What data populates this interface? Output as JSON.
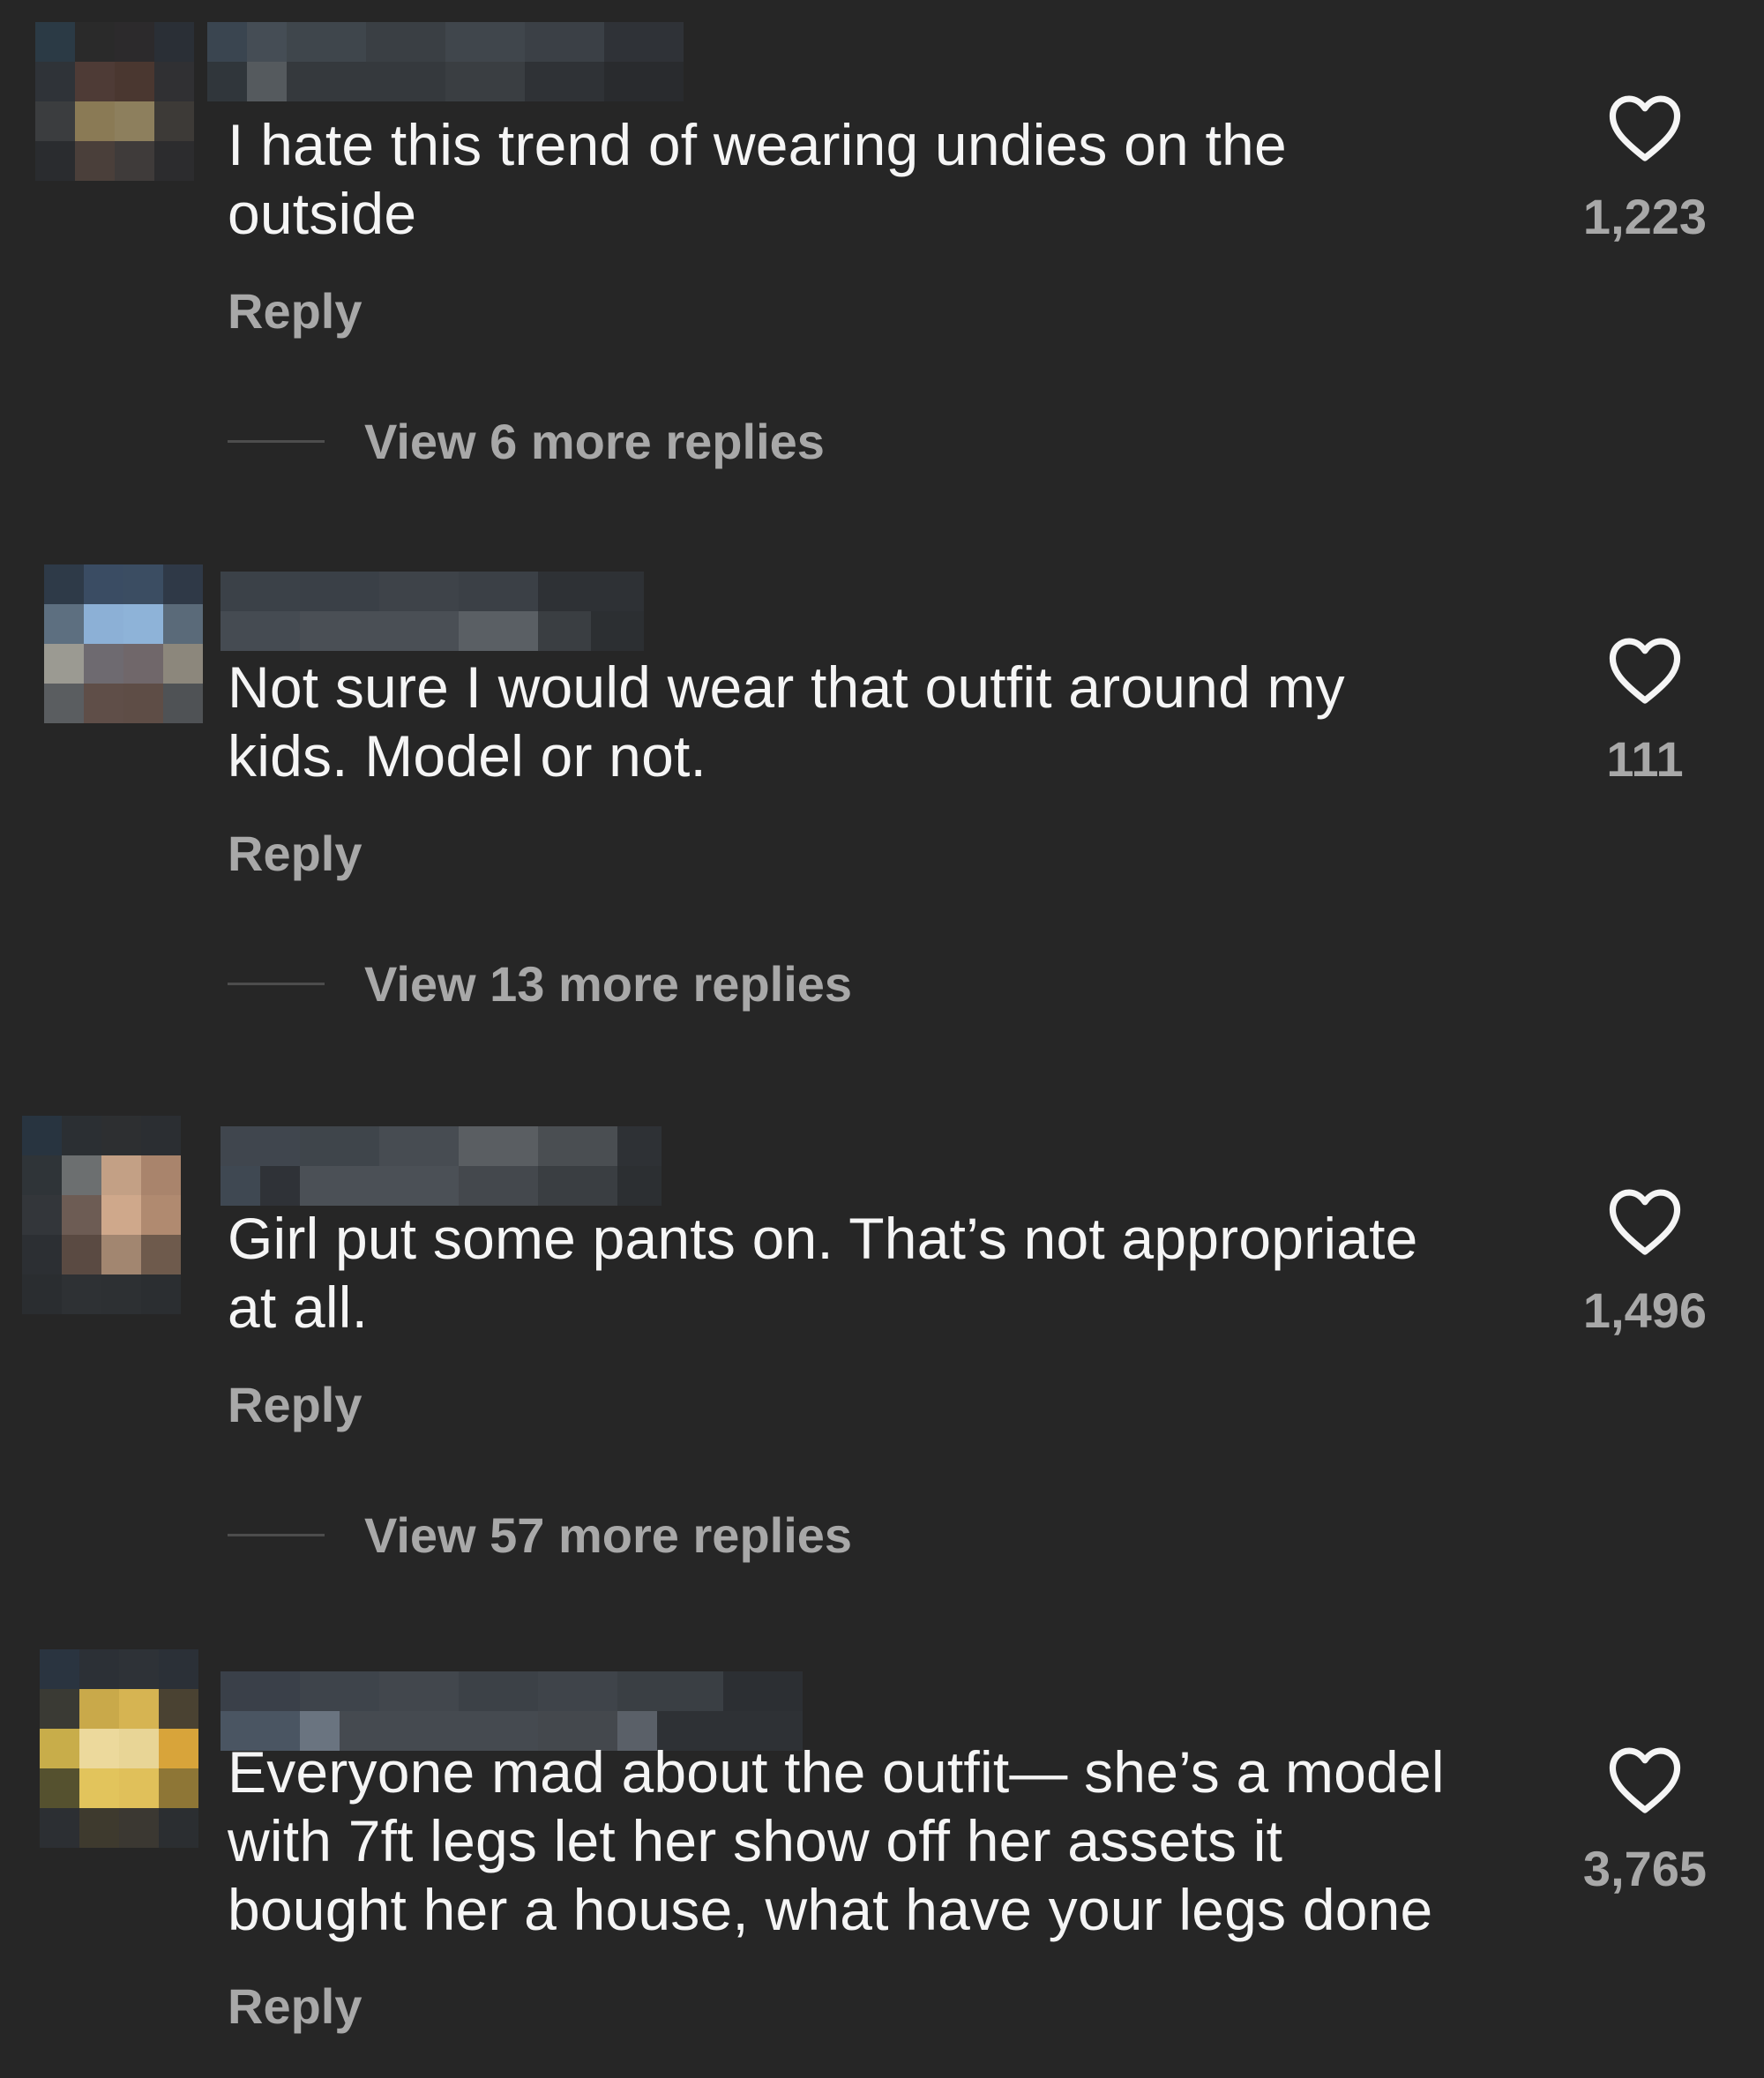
{
  "comments": [
    {
      "text_lines": [
        "I hate this trend of wearing undies on the",
        "outside"
      ],
      "reply_label": "Reply",
      "view_replies_label": "View 6 more replies",
      "likes": "1,223",
      "heart_icon": "heart-outline-icon"
    },
    {
      "text_lines": [
        "Not sure I would wear that outfit around my",
        "kids. Model or not."
      ],
      "reply_label": "Reply",
      "view_replies_label": "View 13 more replies",
      "likes": "111",
      "heart_icon": "heart-outline-icon"
    },
    {
      "text_lines": [
        "Girl put some pants on. That’s not appropriate",
        "at all."
      ],
      "reply_label": "Reply",
      "view_replies_label": "View 57 more replies",
      "likes": "1,496",
      "heart_icon": "heart-outline-icon"
    },
    {
      "text_lines": [
        "Everyone mad about the outfit— she’s a model",
        "with 7ft legs let her show off her assets it",
        "bought her a house, what have your legs done"
      ],
      "reply_label": "Reply",
      "likes": "3,765",
      "heart_icon": "heart-outline-icon"
    }
  ],
  "theme": {
    "background": "#262626",
    "text_primary": "#f5f5f5",
    "text_secondary": "#a8a8a8"
  }
}
